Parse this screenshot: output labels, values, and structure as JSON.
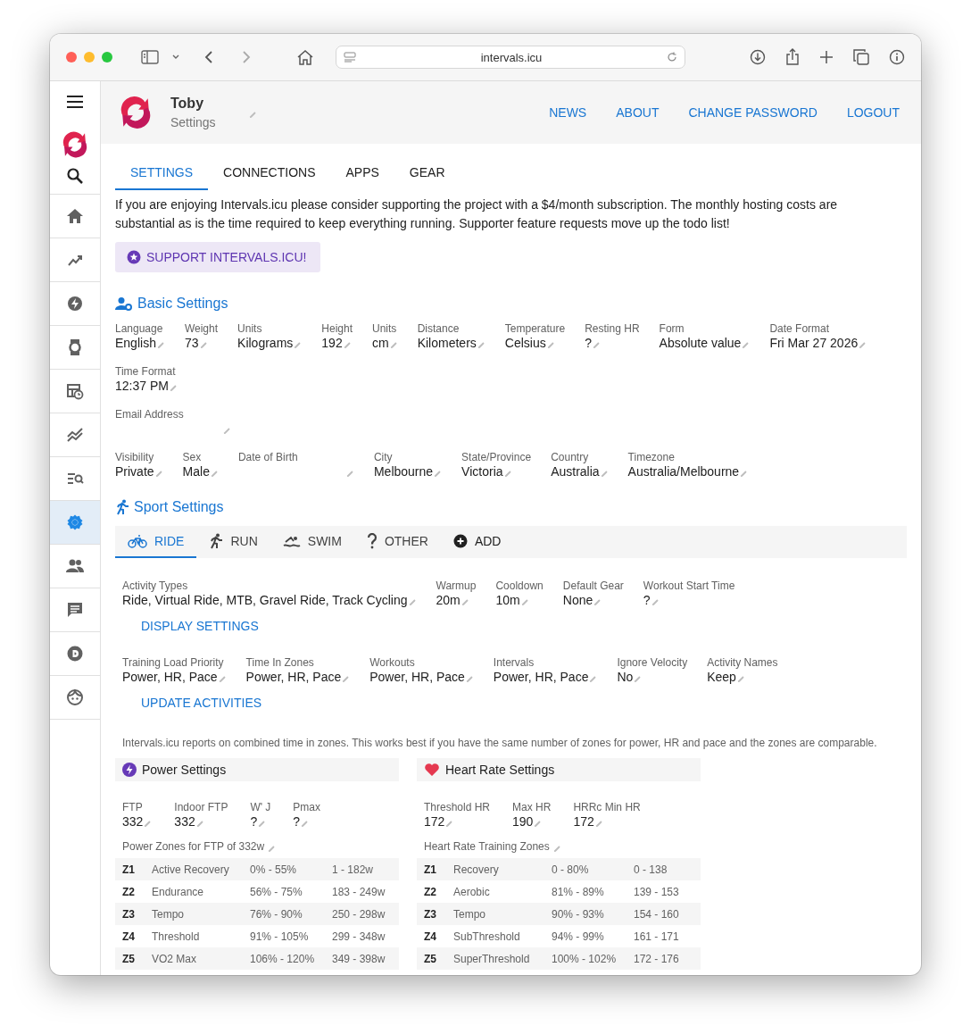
{
  "browser": {
    "url": "intervals.icu"
  },
  "sidebar": {
    "items": [
      {
        "selected": false
      },
      {
        "selected": false
      },
      {
        "selected": false
      },
      {
        "selected": false
      },
      {
        "selected": false
      },
      {
        "selected": false
      },
      {
        "selected": false
      },
      {
        "selected": true
      },
      {
        "selected": false
      },
      {
        "selected": false
      },
      {
        "selected": false
      },
      {
        "selected": false
      }
    ]
  },
  "header": {
    "name": "Toby",
    "subtitle": "Settings",
    "links": [
      "NEWS",
      "ABOUT",
      "CHANGE PASSWORD",
      "LOGOUT"
    ]
  },
  "tabs": [
    {
      "label": "SETTINGS",
      "selected": true
    },
    {
      "label": "CONNECTIONS",
      "selected": false
    },
    {
      "label": "APPS",
      "selected": false
    },
    {
      "label": "GEAR",
      "selected": false
    }
  ],
  "intro": "If you are enjoying Intervals.icu please consider supporting the project with a $4/month subscription. The monthly hosting costs are substantial as is the time required to keep everything running. Supporter feature requests move up the todo list!",
  "support_button": "SUPPORT INTERVALS.ICU!",
  "basic_settings": {
    "title": "Basic Settings",
    "lines": [
      {
        "fields": [
          {
            "label": "Language",
            "value": "English"
          },
          {
            "label": "Weight",
            "value": "73"
          },
          {
            "label": "Units",
            "value": "Kilograms"
          },
          {
            "label": "Height",
            "value": "192"
          },
          {
            "label": "Units",
            "value": "cm"
          },
          {
            "label": "Distance",
            "value": "Kilometers"
          },
          {
            "label": "Temperature",
            "value": "Celsius"
          },
          {
            "label": "Resting HR",
            "value": "?"
          },
          {
            "label": "Form",
            "value": "Absolute value"
          },
          {
            "label": "Date Format",
            "value": "Fri Mar 27 2026"
          }
        ]
      },
      {
        "fields": [
          {
            "label": "Time Format",
            "value": "12:37 PM"
          }
        ]
      },
      {
        "fields": [
          {
            "label": "Email Address"
          }
        ]
      },
      {
        "fields": [
          {
            "label": "Visibility",
            "value": "Private"
          },
          {
            "label": "Sex",
            "value": "Male"
          },
          {
            "label": "Date of Birth"
          },
          {
            "label": "City",
            "value": "Melbourne"
          },
          {
            "label": "State/Province",
            "value": "Victoria"
          },
          {
            "label": "Country",
            "value": "Australia"
          },
          {
            "label": "Timezone",
            "value": "Australia/Melbourne"
          }
        ]
      }
    ]
  },
  "sport_settings": {
    "title": "Sport Settings",
    "tabs": [
      {
        "label": "RIDE",
        "selected": true
      },
      {
        "label": "RUN",
        "selected": false
      },
      {
        "label": "SWIM",
        "selected": false
      },
      {
        "label": "OTHER",
        "selected": false
      }
    ],
    "add_button": "ADD",
    "fields": [
      {
        "label": "Activity Types",
        "value": "Ride, Virtual Ride, MTB, Gravel Ride, Track Cycling"
      },
      {
        "label": "Warmup",
        "value": "20m"
      },
      {
        "label": "Cooldown",
        "value": "10m"
      },
      {
        "label": "Default Gear",
        "value": "None"
      },
      {
        "label": "Workout Start Time",
        "value": "?"
      }
    ],
    "display_button": "DISPLAY SETTINGS",
    "priority_fields": [
      {
        "label": "Training Load Priority",
        "value": "Power, HR, Pace"
      },
      {
        "label": "Time In Zones",
        "value": "Power, HR, Pace"
      },
      {
        "label": "Workouts",
        "value": "Power, HR, Pace"
      },
      {
        "label": "Intervals",
        "value": "Power, HR, Pace"
      },
      {
        "label": "Ignore Velocity",
        "value": "No"
      },
      {
        "label": "Activity Names",
        "value": "Keep"
      }
    ],
    "update_button": "UPDATE ACTIVITIES",
    "note": "Intervals.icu reports on combined time in zones. This works best if you have the same number of zones for power, HR and pace and the zones are comparable."
  },
  "power": {
    "title": "Power Settings",
    "fields": [
      {
        "label": "FTP",
        "value": "332"
      },
      {
        "label": "Indoor FTP",
        "value": "332"
      },
      {
        "label": "W' J",
        "value": "?"
      },
      {
        "label": "Pmax",
        "value": "?"
      }
    ],
    "zones_title": "Power Zones for FTP of 332w",
    "zones": [
      [
        "Z1",
        "Active Recovery",
        "0% - 55%",
        "1 - 182w"
      ],
      [
        "Z2",
        "Endurance",
        "56% - 75%",
        "183 - 249w"
      ],
      [
        "Z3",
        "Tempo",
        "76% - 90%",
        "250 - 298w"
      ],
      [
        "Z4",
        "Threshold",
        "91% - 105%",
        "299 - 348w"
      ],
      [
        "Z5",
        "VO2 Max",
        "106% - 120%",
        "349 - 398w"
      ]
    ]
  },
  "heart_rate": {
    "title": "Heart Rate Settings",
    "fields": [
      {
        "label": "Threshold HR",
        "value": "172"
      },
      {
        "label": "Max HR",
        "value": "190"
      },
      {
        "label": "HRRc Min HR",
        "value": "172"
      }
    ],
    "zones_title": "Heart Rate Training Zones",
    "zones": [
      [
        "Z1",
        "Recovery",
        "0 - 80%",
        "0 - 138"
      ],
      [
        "Z2",
        "Aerobic",
        "81% - 89%",
        "139 - 153"
      ],
      [
        "Z3",
        "Tempo",
        "90% - 93%",
        "154 - 160"
      ],
      [
        "Z4",
        "SubThreshold",
        "94% - 99%",
        "161 - 171"
      ],
      [
        "Z5",
        "SuperThreshold",
        "100% - 102%",
        "172 - 176"
      ]
    ]
  }
}
